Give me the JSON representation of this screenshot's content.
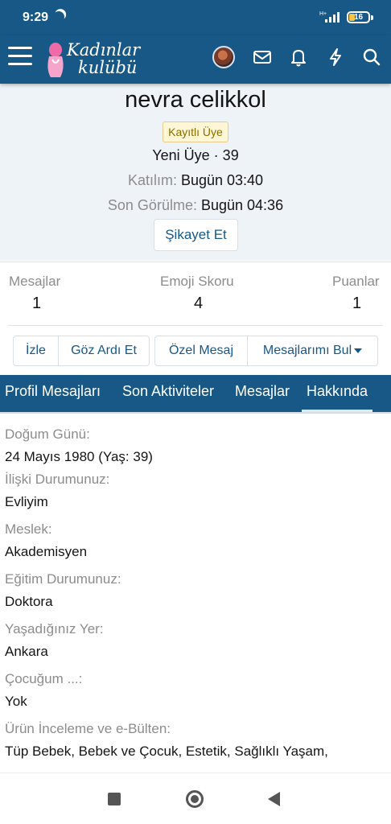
{
  "status_bar": {
    "time": "9:29",
    "signal_label": "H+",
    "battery": "16"
  },
  "header": {
    "logo_line1": "Kadınlar",
    "logo_line2": "kulübü"
  },
  "profile": {
    "name": "nevra celikkol",
    "badge": "Kayıtlı Üye",
    "rank": "Yeni Üye · 39",
    "joined_label": "Katılım:",
    "joined_value": "Bugün 03:40",
    "last_seen_label": "Son Görülme:",
    "last_seen_value": "Bugün 04:36",
    "report_button": "Şikayet Et"
  },
  "stats": [
    {
      "label": "Mesajlar",
      "value": "1"
    },
    {
      "label": "Emoji Skoru",
      "value": "4"
    },
    {
      "label": "Puanlar",
      "value": "1"
    }
  ],
  "actions": {
    "follow": "İzle",
    "ignore": "Göz Ardı Et",
    "private_message": "Özel Mesaj",
    "find_messages": "Mesajlarımı Bul"
  },
  "tabs": [
    {
      "label": "Profil Mesajları"
    },
    {
      "label": "Son Aktiviteler"
    },
    {
      "label": "Mesajlar"
    },
    {
      "label": "Hakkında",
      "active": true
    }
  ],
  "about": [
    {
      "label": "Doğum Günü:",
      "value": "24 Mayıs 1980 (Yaş: 39)"
    },
    {
      "label": "İlişki Durumunuz:",
      "value": "Evliyim"
    },
    {
      "label": "Meslek:",
      "value": "Akademisyen"
    },
    {
      "label": "Eğitim Durumunuz:",
      "value": "Doktora"
    },
    {
      "label": "Yaşadığınız Yer:",
      "value": "Ankara"
    },
    {
      "label": "Çocuğum ...:",
      "value": "Yok"
    },
    {
      "label": "Ürün İnceleme ve e-Bülten:",
      "value": "Tüp Bebek, Bebek ve Çocuk, Estetik, Sağlıklı Yaşam,"
    }
  ],
  "colors": {
    "brand": "#185886",
    "background_head": "#eef3f8",
    "badge_bg": "#fff6d6"
  },
  "icons": [
    "menu-icon",
    "logo-icon",
    "avatar",
    "mail-icon",
    "bell-icon",
    "lightning-icon",
    "search-icon",
    "recents-icon",
    "home-icon",
    "back-icon"
  ]
}
